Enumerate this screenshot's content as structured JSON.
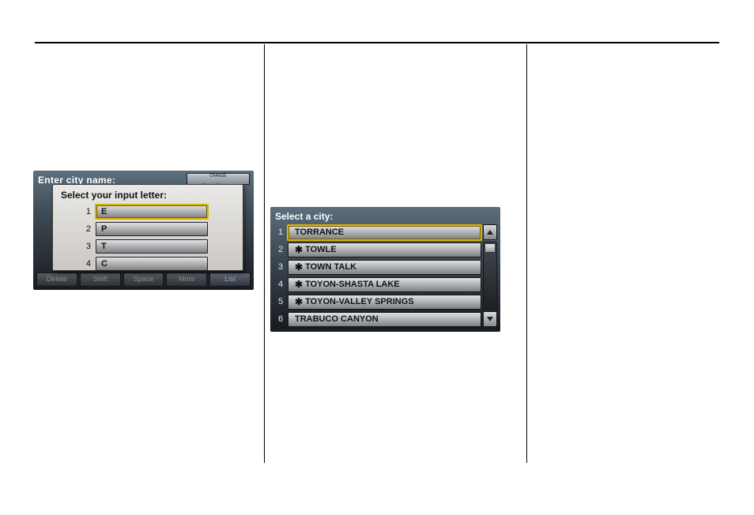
{
  "left_screen": {
    "enter_label": "Enter city name:",
    "say_name": {
      "change": "CHANGE",
      "label": "Say Name"
    },
    "toolbar": {
      "delete": "Delete",
      "shift": "Shift",
      "space": "Space",
      "more": "More",
      "list": "List"
    },
    "popover_title": "Select your input letter:",
    "letters": [
      {
        "n": "1",
        "ch": "E",
        "selected": true
      },
      {
        "n": "2",
        "ch": "P",
        "selected": false
      },
      {
        "n": "3",
        "ch": "T",
        "selected": false
      },
      {
        "n": "4",
        "ch": "C",
        "selected": false
      }
    ]
  },
  "right_screen": {
    "title": "Select a city:",
    "rows": [
      {
        "n": "1",
        "name": "TORRANCE",
        "star": false,
        "selected": true
      },
      {
        "n": "2",
        "name": "TOWLE",
        "star": true,
        "selected": false
      },
      {
        "n": "3",
        "name": "TOWN TALK",
        "star": true,
        "selected": false
      },
      {
        "n": "4",
        "name": "TOYON-SHASTA LAKE",
        "star": true,
        "selected": false
      },
      {
        "n": "5",
        "name": "TOYON-VALLEY SPRINGS",
        "star": true,
        "selected": false
      },
      {
        "n": "6",
        "name": "TRABUCO CANYON",
        "star": false,
        "selected": false
      }
    ]
  }
}
